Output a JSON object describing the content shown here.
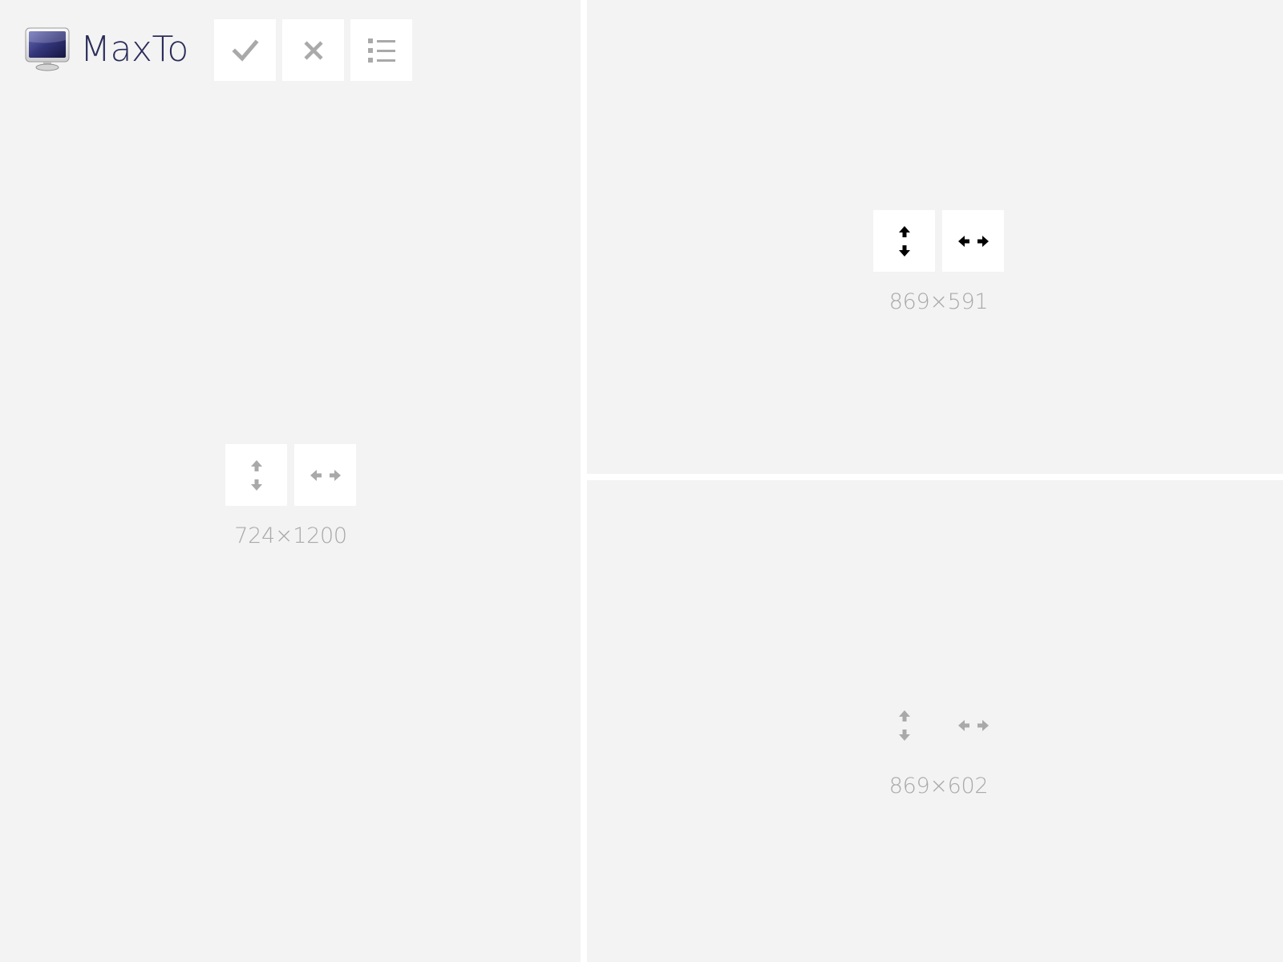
{
  "app": {
    "title": "MaxTo"
  },
  "toolbar": {
    "items": [
      {
        "icon": "checkmark-icon",
        "action": "apply"
      },
      {
        "icon": "close-icon",
        "action": "cancel"
      },
      {
        "icon": "list-icon",
        "action": "menu"
      }
    ]
  },
  "regions": [
    {
      "id": "left",
      "size_label": "724×1200",
      "icon_style": "gray",
      "boxed": true
    },
    {
      "id": "top-right",
      "size_label": "869×591",
      "icon_style": "black",
      "boxed": true
    },
    {
      "id": "bottom-right",
      "size_label": "869×602",
      "icon_style": "gray",
      "boxed": false
    }
  ],
  "colors": {
    "background": "#f3f3f3",
    "divider": "#ffffff",
    "title": "#2b2d5a",
    "icon_gray": "#a9a9a9",
    "icon_black": "#000000",
    "label": "#a9a9a9"
  }
}
